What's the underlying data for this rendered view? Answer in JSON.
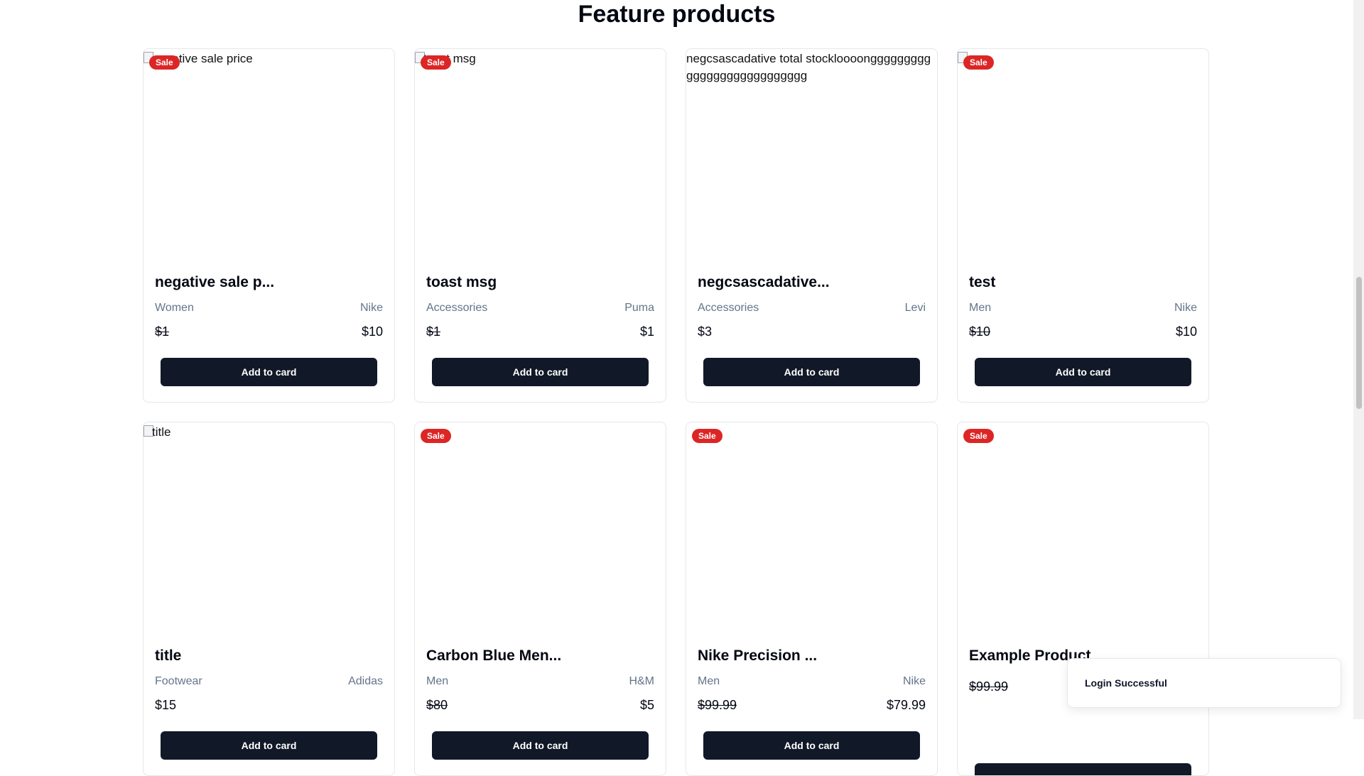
{
  "section": {
    "title": "Feature products"
  },
  "toast": {
    "message": "Login Successful"
  },
  "products": [
    {
      "alt": "negative sale price",
      "sale_badge": "Sale",
      "name": "negative sale p...",
      "category": "Women",
      "brand": "Nike",
      "price_left": "$1",
      "price_right": "$10",
      "button": "Add to card"
    },
    {
      "alt": "toast msg",
      "sale_badge": "Sale",
      "name": "toast msg",
      "category": "Accessories",
      "brand": "Puma",
      "price_left": "$1",
      "price_right": "$1",
      "button": "Add to card"
    },
    {
      "alt": "negcsascadative total stockloooonggggggggggggggggggggggggggg",
      "sale_badge": "",
      "name": "negcsascadative...",
      "category": "Accessories",
      "brand": "Levi",
      "price_left": "$3",
      "price_right": "",
      "button": "Add to card"
    },
    {
      "alt": "",
      "sale_badge": "Sale",
      "name": "test",
      "category": "Men",
      "brand": "Nike",
      "price_left": "$10",
      "price_right": "$10",
      "button": "Add to card"
    },
    {
      "alt": "title",
      "sale_badge": "",
      "name": "title",
      "category": "Footwear",
      "brand": "Adidas",
      "price_left": "$15",
      "price_right": "",
      "button": "Add to card"
    },
    {
      "alt": "",
      "sale_badge": "Sale",
      "name": "Carbon Blue Men...",
      "category": "Men",
      "brand": "H&M",
      "price_left": "$80",
      "price_right": "$5",
      "button": "Add to card"
    },
    {
      "alt": "",
      "sale_badge": "Sale",
      "name": "Nike Precision ...",
      "category": "Men",
      "brand": "Nike",
      "price_left": "$99.99",
      "price_right": "$79.99",
      "button": "Add to card"
    },
    {
      "alt": "",
      "sale_badge": "Sale",
      "name": "Example Product",
      "category": "",
      "brand": "",
      "price_left": "$99.99",
      "price_right": "",
      "button": ""
    }
  ]
}
